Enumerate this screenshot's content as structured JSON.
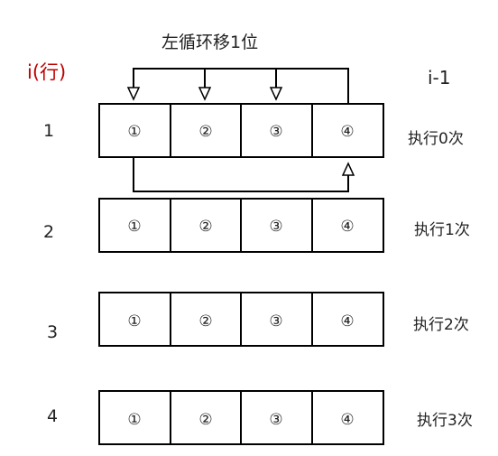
{
  "title": "左循环移1位",
  "axis_left_label": "i(行)",
  "axis_right_label": "i-1",
  "rows": [
    {
      "index": "1",
      "cells": [
        "①",
        "②",
        "③",
        "④"
      ],
      "exec_label": "执行0次"
    },
    {
      "index": "2",
      "cells": [
        "①",
        "②",
        "③",
        "④"
      ],
      "exec_label": "执行1次"
    },
    {
      "index": "3",
      "cells": [
        "①",
        "②",
        "③",
        "④"
      ],
      "exec_label": "执行2次"
    },
    {
      "index": "4",
      "cells": [
        "①",
        "②",
        "③",
        "④"
      ],
      "exec_label": "执行3次"
    }
  ],
  "colors": {
    "axis_label": "#c00000",
    "stroke": "#000000"
  }
}
